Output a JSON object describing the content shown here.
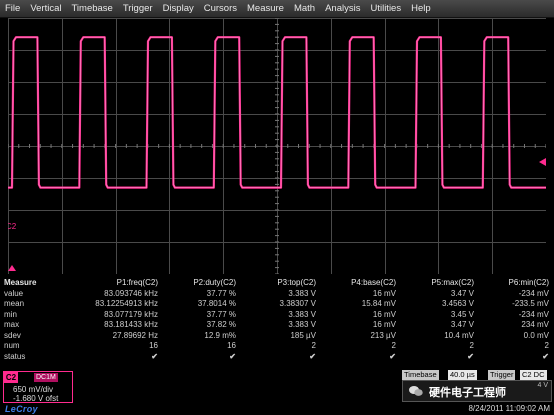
{
  "menu": [
    "File",
    "Vertical",
    "Timebase",
    "Trigger",
    "Display",
    "Cursors",
    "Measure",
    "Math",
    "Analysis",
    "Utilities",
    "Help"
  ],
  "colors": {
    "trace": "#ff2b8f",
    "grid": "#4a4a4a",
    "accent": "#3e7fe8",
    "check": "#33cc33"
  },
  "screen": {
    "channel_marker": "C2",
    "trace": {
      "high_level_div": 3.4,
      "low_level_div": -1.3,
      "periods": 8,
      "duty": 0.3777
    }
  },
  "measure": {
    "header": [
      "Measure",
      "P1:freq(C2)",
      "P2:duty(C2)",
      "P3:top(C2)",
      "P4:base(C2)",
      "P5:max(C2)",
      "P6:min(C2)"
    ],
    "rows": [
      [
        "value",
        "83.093746 kHz",
        "37.77 %",
        "3.383 V",
        "16 mV",
        "3.47 V",
        "-234 mV"
      ],
      [
        "mean",
        "83.12254913 kHz",
        "37.8014 %",
        "3.38307 V",
        "15.84 mV",
        "3.4563 V",
        "-233.5 mV"
      ],
      [
        "min",
        "83.077179 kHz",
        "37.77 %",
        "3.383 V",
        "16 mV",
        "3.45 V",
        "-234 mV"
      ],
      [
        "max",
        "83.181433 kHz",
        "37.82 %",
        "3.383 V",
        "16 mV",
        "3.47 V",
        "234 mV"
      ],
      [
        "sdev",
        "27.89692 Hz",
        "12.9 m%",
        "185 µV",
        "213 µV",
        "10.4 mV",
        "0.0 mV"
      ],
      [
        "num",
        "16",
        "16",
        "2",
        "2",
        "2",
        "2"
      ],
      [
        "status",
        "✔",
        "✔",
        "✔",
        "✔",
        "✔",
        "✔"
      ]
    ]
  },
  "channel": {
    "tag": "C2",
    "coupling": "DC1M",
    "vdiv": "650 mV/div",
    "offset": "-1.680 V ofst"
  },
  "brand": "LeCroy",
  "timebase": {
    "label": "Timebase",
    "value": "40.0 µs",
    "trigger_label": "Trigger",
    "trigger_value": "C2 DC",
    "edge": "4 V",
    "watermark": "硬件电子工程师"
  },
  "timestamp": "8/24/2011 11:09:02 AM"
}
